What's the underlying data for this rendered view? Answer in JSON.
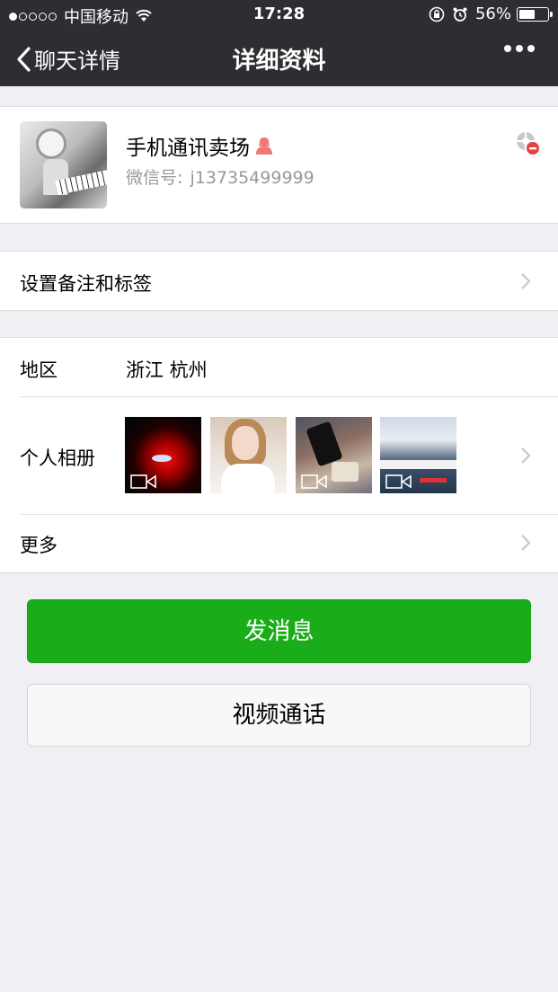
{
  "status_bar": {
    "carrier": "中国移动",
    "time": "17:28",
    "battery_percent": "56%",
    "battery_level": 0.56,
    "signal_bars_filled": 1,
    "signal_bars_total": 5
  },
  "nav": {
    "back_label": "聊天详情",
    "title": "详细资料"
  },
  "profile": {
    "name": "手机通讯卖场",
    "wechat_id_label": "微信号:",
    "wechat_id": "j13735499999",
    "gender_icon": "female-icon",
    "status_icon": "blocked-icon"
  },
  "tags_row": {
    "label": "设置备注和标签"
  },
  "region_row": {
    "label": "地区",
    "value": "浙江  杭州"
  },
  "album_row": {
    "label": "个人相册",
    "thumbnails": [
      {
        "name": "album-thumb-1",
        "is_video": true
      },
      {
        "name": "album-thumb-2",
        "is_video": false
      },
      {
        "name": "album-thumb-3",
        "is_video": true
      },
      {
        "name": "album-thumb-4",
        "is_video": true
      }
    ]
  },
  "more_row": {
    "label": "更多"
  },
  "buttons": {
    "send_message": "发消息",
    "video_call": "视频通话"
  },
  "colors": {
    "nav_background": "#2e2e32",
    "page_background": "#efeff4",
    "primary_green": "#1aad19",
    "female_icon": "#f07878",
    "blocked_red": "#e64340"
  }
}
